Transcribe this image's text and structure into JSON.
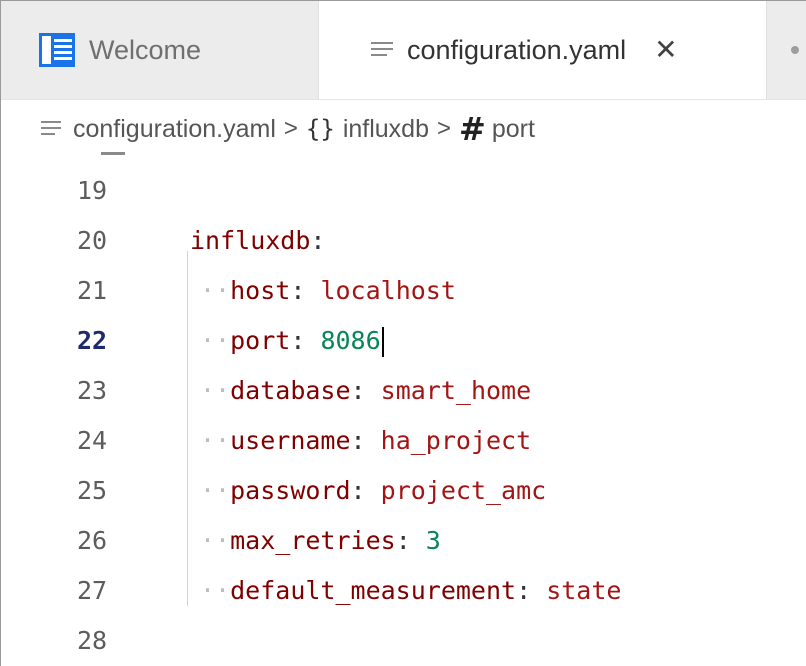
{
  "tabs": [
    {
      "label": "Welcome",
      "icon": "vscode-welcome-icon",
      "active": false
    },
    {
      "label": "configuration.yaml",
      "icon": "file-lines-icon",
      "active": true,
      "close": "✕"
    }
  ],
  "breadcrumb": {
    "file": "configuration.yaml",
    "object": "influxdb",
    "field": "port",
    "separator": ">",
    "object_symbol": "{}",
    "field_symbol": "#"
  },
  "editor": {
    "active_line": 22,
    "lines": [
      {
        "num": "19",
        "key": "",
        "colon": "",
        "value": "",
        "type": "blank"
      },
      {
        "num": "20",
        "key": "influxdb",
        "colon": ":",
        "value": "",
        "type": "section"
      },
      {
        "num": "21",
        "key": "host",
        "colon": ": ",
        "value": "localhost",
        "type": "str"
      },
      {
        "num": "22",
        "key": "port",
        "colon": ": ",
        "value": "8086",
        "type": "num"
      },
      {
        "num": "23",
        "key": "database",
        "colon": ": ",
        "value": "smart_home",
        "type": "str"
      },
      {
        "num": "24",
        "key": "username",
        "colon": ": ",
        "value": "ha_project",
        "type": "str"
      },
      {
        "num": "25",
        "key": "password",
        "colon": ": ",
        "value": "project_amc",
        "type": "str"
      },
      {
        "num": "26",
        "key": "max_retries",
        "colon": ": ",
        "value": "3",
        "type": "num"
      },
      {
        "num": "27",
        "key": "default_measurement",
        "colon": ": ",
        "value": "state",
        "type": "str"
      },
      {
        "num": "28",
        "key": "",
        "colon": "",
        "value": "",
        "type": "blank"
      }
    ]
  },
  "colors": {
    "key": "#800000",
    "string_value": "#a31515",
    "number_value": "#098658",
    "accent_icon": "#1a73e8"
  }
}
